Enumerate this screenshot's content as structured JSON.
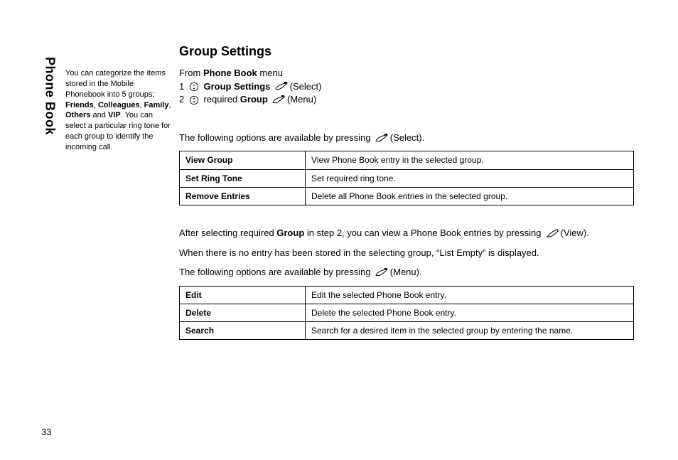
{
  "side_tab": "Phone Book",
  "intro": {
    "pre": "You can categorize the items stored in the Mobile Phonebook into 5 groups; ",
    "groups": [
      "Friends",
      "Colleagues",
      "Family",
      "Others",
      "VIP"
    ],
    "sep": ", ",
    "and": " and ",
    "post": ". You can select a particular ring tone for each group to identify the incoming call."
  },
  "title": "Group Settings",
  "steps": {
    "from_pre": "From ",
    "from_bold": "Phone Book",
    "from_post": " menu",
    "s1_num": "1",
    "s1_bold": "Group Settings",
    "s1_post": " (Select)",
    "s2_num": "2",
    "s2_mid": " required ",
    "s2_bold": "Group",
    "s2_post": " (Menu)"
  },
  "p_avail1": "The following options are available by pressing ",
  "p_avail1_post": " (Select).",
  "table1": [
    {
      "k": "View Group",
      "v": "View Phone Book entry in the selected group."
    },
    {
      "k": "Set Ring Tone",
      "v": "Set required ring tone."
    },
    {
      "k": "Remove Entries",
      "v": "Delete all Phone Book entries in the selected group."
    }
  ],
  "after_select": {
    "pre": "After selecting required ",
    "bold1": "Group",
    "mid": " in step 2, you can view a Phone Book entries by pressing ",
    "post": " (View)."
  },
  "p_empty": "When there is no entry has been stored in the selecting group, “List Empty” is displayed.",
  "p_avail2": "The following options are available by pressing ",
  "p_avail2_post": " (Menu).",
  "table2": [
    {
      "k": "Edit",
      "v": "Edit the selected Phone Book entry."
    },
    {
      "k": "Delete",
      "v": "Delete the selected Phone Book entry."
    },
    {
      "k": "Search",
      "v": "Search for a desired item in the selected group by entering the name."
    }
  ],
  "page_number": "33"
}
